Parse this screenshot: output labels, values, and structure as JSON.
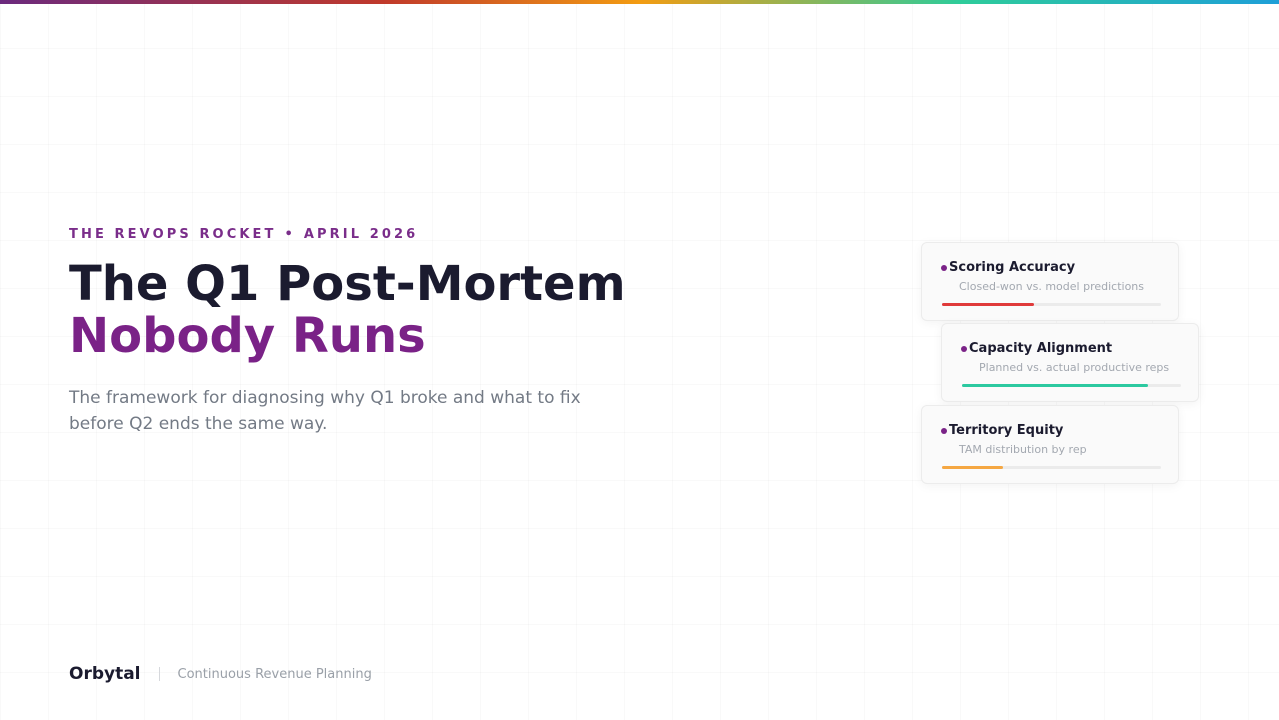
{
  "eyebrow": {
    "publication": "THE REVOPS ROCKET",
    "separator": "•",
    "date": "APRIL 2026"
  },
  "title": {
    "line1": "The Q1 Post-Mortem",
    "line2": "Nobody Runs"
  },
  "subtitle": "The framework for diagnosing why Q1 broke and what to fix before Q2 ends the same way.",
  "cards": [
    {
      "name": "Scoring Accuracy",
      "desc": "Closed-won vs. model predictions",
      "level": 0.42,
      "color": "#e03a3a"
    },
    {
      "name": "Capacity Alignment",
      "desc": "Planned vs. actual productive reps",
      "level": 0.85,
      "color": "#2cc9a0"
    },
    {
      "name": "Territory Equity",
      "desc": "TAM distribution by rep",
      "level": 0.28,
      "color": "#f5a742"
    }
  ],
  "footer": {
    "brand": "Orbytal",
    "tagline": "Continuous Revenue Planning"
  },
  "colors": {
    "accent": "#7a2287",
    "text": "#1b1b2f"
  }
}
